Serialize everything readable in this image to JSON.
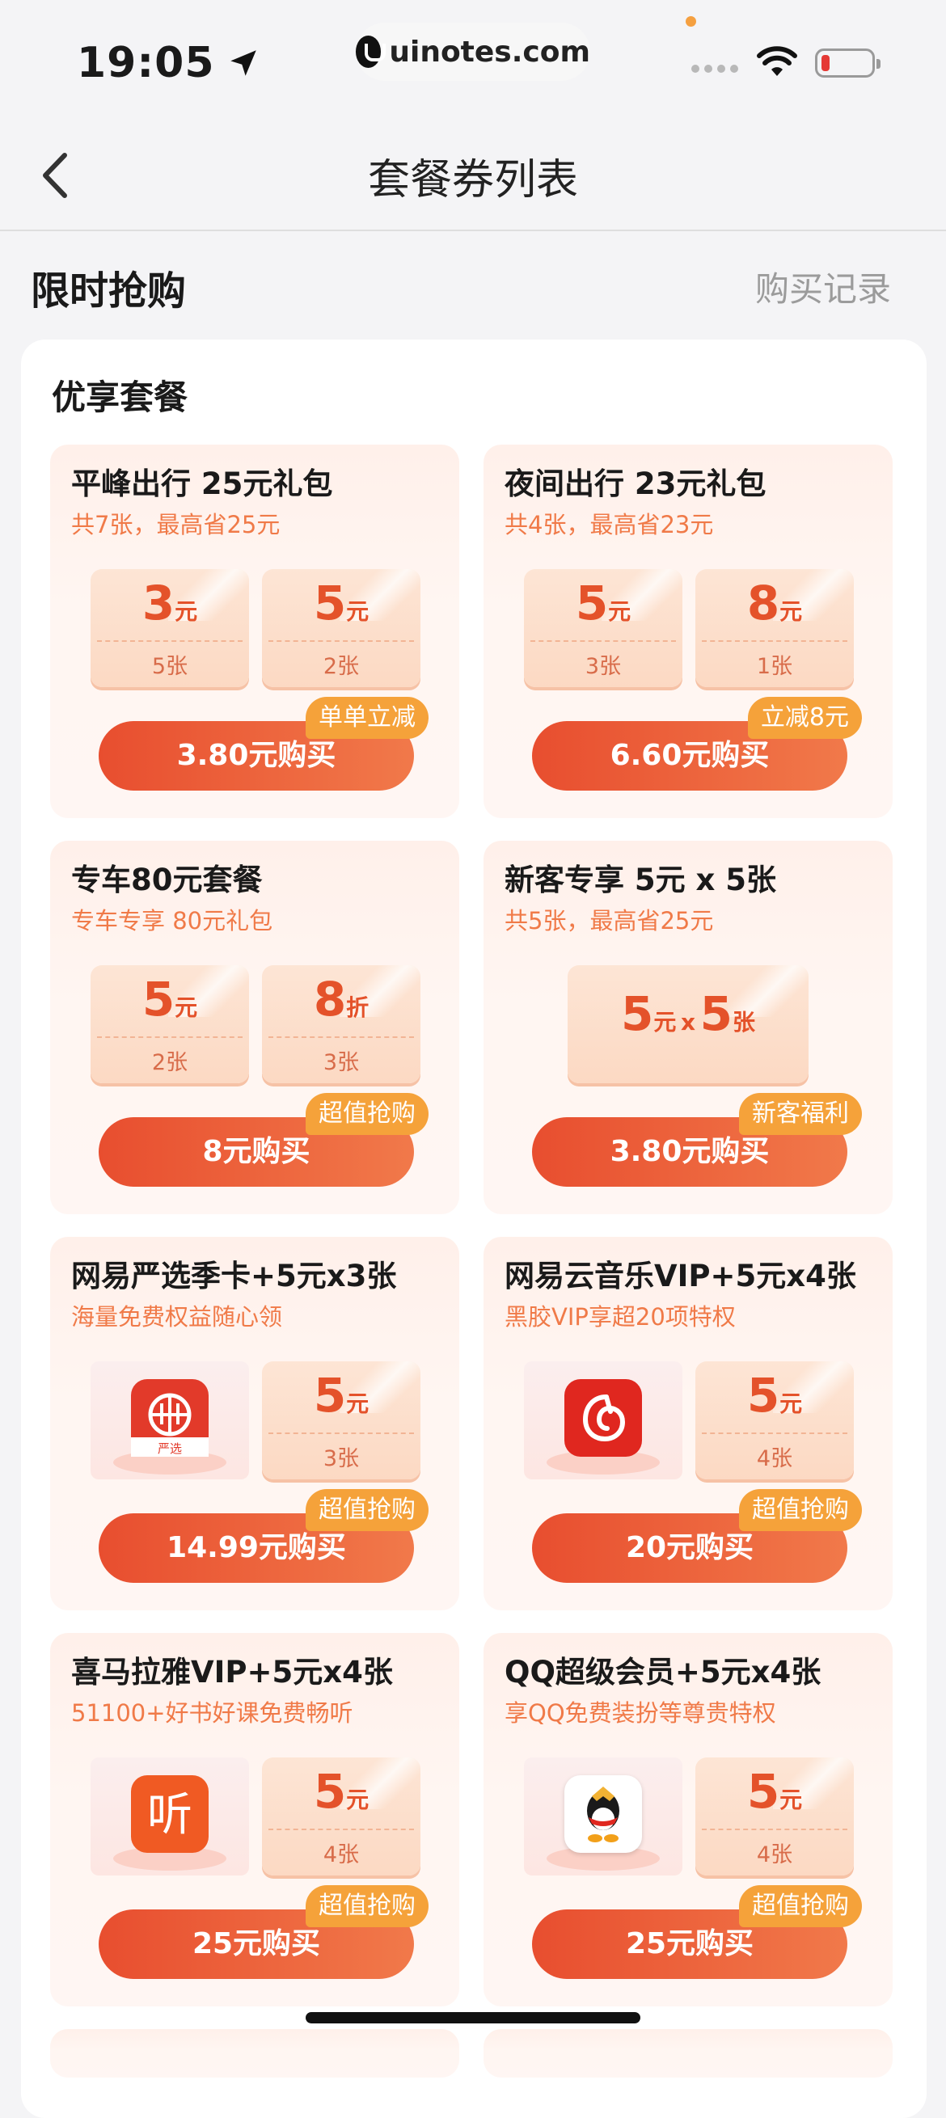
{
  "status_bar": {
    "time": "19:05",
    "url": "uinotes.com"
  },
  "nav": {
    "title": "套餐券列表"
  },
  "section": {
    "title": "限时抢购",
    "link": "购买记录"
  },
  "panel": {
    "title": "优享套餐"
  },
  "cards": [
    {
      "title": "平峰出行 25元礼包",
      "subtitle": "共7张，最高省25元",
      "coupons": [
        {
          "amount": "3",
          "unit": "元",
          "count": "5张"
        },
        {
          "amount": "5",
          "unit": "元",
          "count": "2张"
        }
      ],
      "button": "3.80元购买",
      "tag": "单单立减"
    },
    {
      "title": "夜间出行 23元礼包",
      "subtitle": "共4张，最高省23元",
      "coupons": [
        {
          "amount": "5",
          "unit": "元",
          "count": "3张"
        },
        {
          "amount": "8",
          "unit": "元",
          "count": "1张"
        }
      ],
      "button": "6.60元购买",
      "tag": "立减8元"
    },
    {
      "title": "专车80元套餐",
      "subtitle": "专车专享 80元礼包",
      "coupons": [
        {
          "amount": "5",
          "unit": "元",
          "count": "2张"
        },
        {
          "amount": "8",
          "unit": "折",
          "count": "3张"
        }
      ],
      "button": "8元购买",
      "tag": "超值抢购"
    },
    {
      "title": "新客专享 5元 x 5张",
      "subtitle": "共5张，最高省25元",
      "wide_coupon": {
        "amount": "5",
        "unit": "元",
        "x": "x",
        "count_n": "5",
        "count_u": "张"
      },
      "button": "3.80元购买",
      "tag": "新客福利"
    },
    {
      "title": "网易严选季卡+5元x3张",
      "subtitle": "海量免费权益随心领",
      "product_icon": "yanxuan-app-icon",
      "product_icon_text": "严选",
      "coupons": [
        {
          "amount": "5",
          "unit": "元",
          "count": "3张"
        }
      ],
      "button": "14.99元购买",
      "tag": "超值抢购"
    },
    {
      "title": "网易云音乐VIP+5元x4张",
      "subtitle": "黑胶VIP享超20项特权",
      "product_icon": "netease-music-app-icon",
      "coupons": [
        {
          "amount": "5",
          "unit": "元",
          "count": "4张"
        }
      ],
      "button": "20元购买",
      "tag": "超值抢购"
    },
    {
      "title": "喜马拉雅VIP+5元x4张",
      "subtitle": "51100+好书好课免费畅听",
      "product_icon": "ximalaya-app-icon",
      "product_icon_text": "听",
      "coupons": [
        {
          "amount": "5",
          "unit": "元",
          "count": "4张"
        }
      ],
      "button": "25元购买",
      "tag": "超值抢购"
    },
    {
      "title": "QQ超级会员+5元x4张",
      "subtitle": "享QQ免费装扮等尊贵特权",
      "product_icon": "qq-app-icon",
      "coupons": [
        {
          "amount": "5",
          "unit": "元",
          "count": "4张"
        }
      ],
      "button": "25元购买",
      "tag": "超值抢购"
    }
  ]
}
